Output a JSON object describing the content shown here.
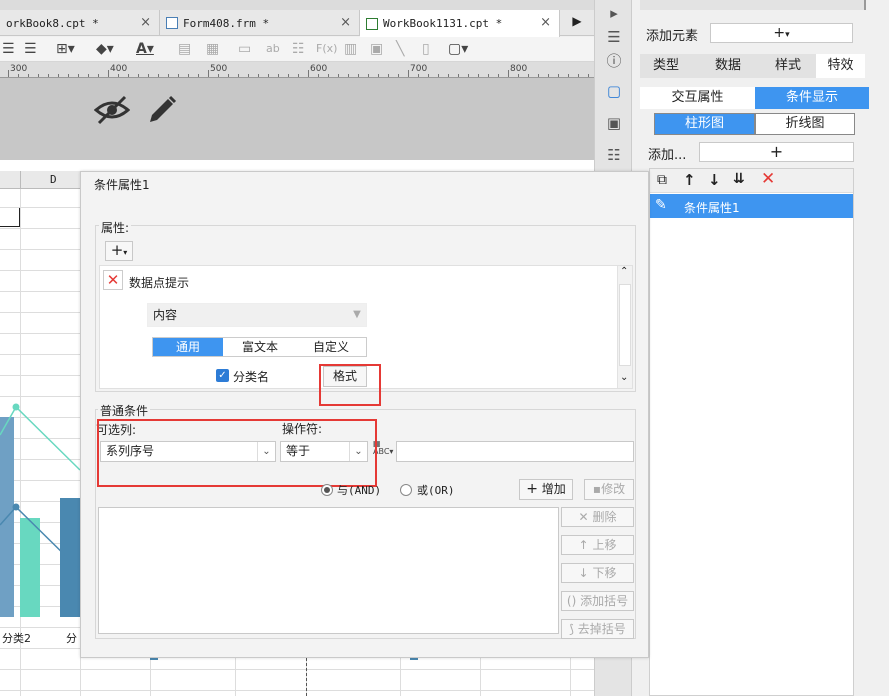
{
  "tabs": [
    {
      "label": "orkBook8.cpt *",
      "close": "×"
    },
    {
      "label": "Form408.frm *",
      "close": "×"
    },
    {
      "label": "WorkBook1131.cpt *",
      "close": "×"
    }
  ],
  "ruler": {
    "labels": [
      "300",
      "400",
      "500",
      "600",
      "700",
      "800"
    ]
  },
  "sheet": {
    "column_label": "D",
    "category_labels": [
      "分类2",
      "分"
    ]
  },
  "sidebar": {
    "add_element_label": "添加元素",
    "main_tabs": [
      "类型",
      "数据",
      "样式",
      "特效"
    ],
    "sub_tabs": [
      "交互属性",
      "条件显示"
    ],
    "chart_tabs": [
      "柱形图",
      "折线图"
    ],
    "add_label": "添加...",
    "add_button": "+",
    "list_item": "条件属性1"
  },
  "dialog": {
    "title": "条件属性1",
    "props_label": "属性:",
    "add_plus": "+",
    "datapoint_tip": "数据点提示",
    "content_combo": "内容",
    "content_tabs": [
      "通用",
      "富文本",
      "自定义"
    ],
    "category_checkbox": "分类名",
    "format_button": "格式",
    "cond_label": "普通条件",
    "column_label": "可选列:",
    "operator_label": "操作符:",
    "column_value": "系列序号",
    "operator_value": "等于",
    "and_label": "与(AND)",
    "or_label": "或(OR)",
    "add_button": "增加",
    "modify_button": "修改",
    "side_buttons": [
      "删除",
      "上移",
      "下移",
      "添加括号",
      "去掉括号"
    ]
  },
  "colors": {
    "accent": "#3e95f0",
    "red": "#e53935",
    "chart_teal": "#68d8c0",
    "chart_blue": "#4a88b0"
  }
}
